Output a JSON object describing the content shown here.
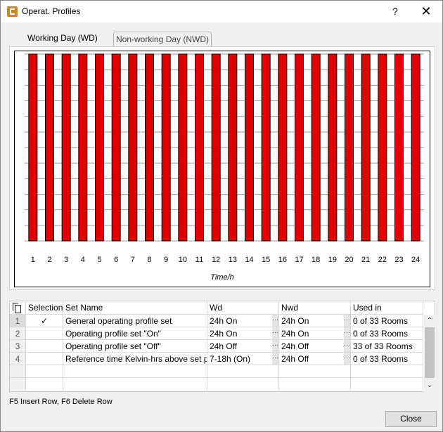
{
  "window": {
    "title": "Operat. Profiles",
    "help_label": "?",
    "close_glyph": "✕"
  },
  "tabs": [
    {
      "label": "Working Day (WD)",
      "active": true
    },
    {
      "label": "Non-working Day (NWD)",
      "active": false
    }
  ],
  "chart_data": {
    "type": "bar",
    "categories": [
      "1",
      "2",
      "3",
      "4",
      "5",
      "6",
      "7",
      "8",
      "9",
      "10",
      "11",
      "12",
      "13",
      "14",
      "15",
      "16",
      "17",
      "18",
      "19",
      "20",
      "21",
      "22",
      "23",
      "24"
    ],
    "values": [
      1,
      1,
      1,
      1,
      1,
      1,
      1,
      1,
      1,
      1,
      1,
      1,
      1,
      1,
      1,
      1,
      1,
      1,
      1,
      1,
      1,
      1,
      1,
      1
    ],
    "xlabel": "Time/h",
    "ylabel": "",
    "ylim": [
      0,
      1
    ],
    "grid": true,
    "bar_color": "#e00000"
  },
  "table": {
    "headers": [
      "Selection",
      "Set Name",
      "Wd",
      "Nwd",
      "Used in"
    ],
    "rows": [
      {
        "num": "1",
        "selected": "✓",
        "name": "General operating profile set",
        "wd": "24h On",
        "nwd": "24h On",
        "used": "0 of 33 Rooms"
      },
      {
        "num": "2",
        "selected": "",
        "name": "Operating profile set \"On\"",
        "wd": "24h On",
        "nwd": "24h On",
        "used": "0 of 33 Rooms"
      },
      {
        "num": "3",
        "selected": "",
        "name": "Operating profile set \"Off\"",
        "wd": "24h Off",
        "nwd": "24h Off",
        "used": "33 of 33 Rooms"
      },
      {
        "num": "4",
        "selected": "",
        "name": "Reference time Kelvin-hrs above set point",
        "wd": "7-18h (On)",
        "nwd": "24h Off",
        "used": "0 of 33 Rooms"
      }
    ],
    "ellipsis": "···"
  },
  "hint": "F5 Insert Row, F6 Delete Row",
  "close_label": "Close"
}
